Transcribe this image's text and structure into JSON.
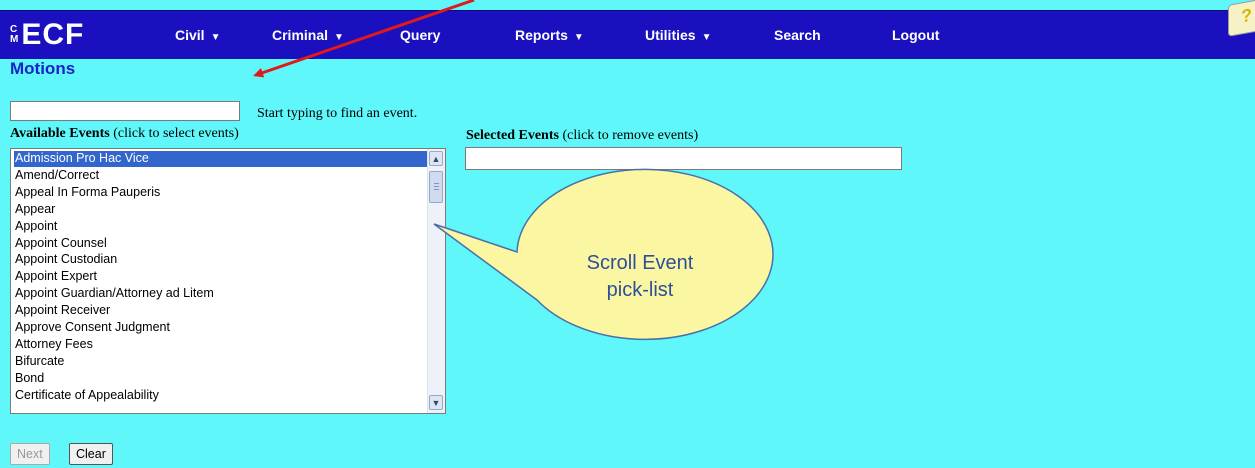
{
  "app": {
    "logo_prefix": "CM",
    "logo_text": "ECF"
  },
  "nav": {
    "civil": "Civil",
    "criminal": "Criminal",
    "query": "Query",
    "reports": "Reports",
    "utilities": "Utilities",
    "search": "Search",
    "logout": "Logout"
  },
  "page": {
    "title": "Motions"
  },
  "event_search": {
    "value": "",
    "hint": "Start typing to find an event."
  },
  "available": {
    "label_bold": "Available Events",
    "label_rest": " (click to select events)",
    "items": [
      "Admission Pro Hac Vice",
      "Amend/Correct",
      "Appeal In Forma Pauperis",
      "Appear",
      "Appoint",
      "Appoint Counsel",
      "Appoint Custodian",
      "Appoint Expert",
      "Appoint Guardian/Attorney ad Litem",
      "Appoint Receiver",
      "Approve Consent Judgment",
      "Attorney Fees",
      "Bifurcate",
      "Bond",
      "Certificate of Appealability"
    ],
    "selected_index": 0
  },
  "selected": {
    "label_bold": "Selected Events",
    "label_rest": " (click to remove events)"
  },
  "buttons": {
    "next": "Next",
    "clear": "Clear"
  },
  "callout": {
    "line1": "Scroll Event",
    "line2": "pick-list"
  },
  "colors": {
    "background": "#5ff7f9",
    "navbar": "#1a10bf",
    "title": "#1a22c8",
    "selection": "#3366cc",
    "callout_fill": "#fbf6a1",
    "arrow": "#e0191b"
  }
}
